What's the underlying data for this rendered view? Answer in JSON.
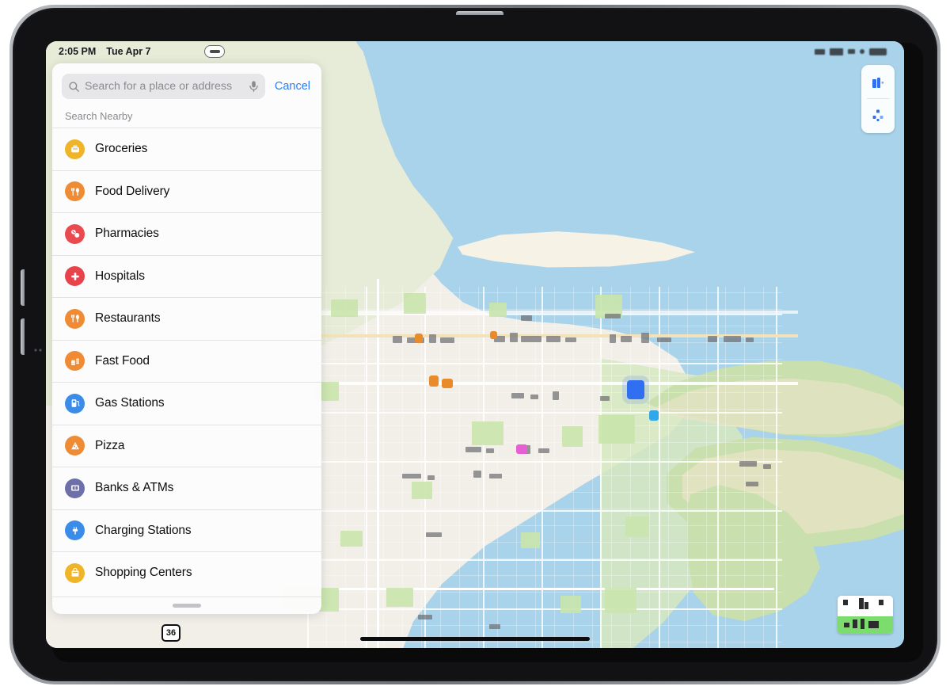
{
  "device": {
    "name": "iPad",
    "orientation": "landscape"
  },
  "status_bar": {
    "time": "2:05 PM",
    "date": "Tue Apr 7",
    "right_icons": [
      "wifi-icon",
      "cellular-signal-icon",
      "bluetooth-icon",
      "battery-icon"
    ]
  },
  "search": {
    "placeholder": "Search for a place or address",
    "value": "",
    "search_icon": "search-icon",
    "mic_icon": "microphone-icon",
    "cancel_label": "Cancel"
  },
  "panel": {
    "section_header": "Search Nearby",
    "grabber": "panel-drag-handle"
  },
  "nearby": {
    "items": [
      {
        "label": "Groceries",
        "icon": "shopping-basket-icon",
        "color": "#f0b429"
      },
      {
        "label": "Food Delivery",
        "icon": "utensils-icon",
        "color": "#ef8b34"
      },
      {
        "label": "Pharmacies",
        "icon": "pills-icon",
        "color": "#ea4a4f"
      },
      {
        "label": "Hospitals",
        "icon": "medical-cross-icon",
        "color": "#e8434a"
      },
      {
        "label": "Restaurants",
        "icon": "utensils-icon",
        "color": "#ef8b34"
      },
      {
        "label": "Fast Food",
        "icon": "burger-fries-icon",
        "color": "#ef8b34"
      },
      {
        "label": "Gas Stations",
        "icon": "fuel-pump-icon",
        "color": "#3b8ce8"
      },
      {
        "label": "Pizza",
        "icon": "pizza-slice-icon",
        "color": "#ef8b34"
      },
      {
        "label": "Banks & ATMs",
        "icon": "banknote-icon",
        "color": "#6d6fa8"
      },
      {
        "label": "Charging Stations",
        "icon": "ev-plug-icon",
        "color": "#3b8ce8"
      },
      {
        "label": "Shopping Centers",
        "icon": "shopping-bag-icon",
        "color": "#f0b429"
      }
    ]
  },
  "map": {
    "controls": [
      {
        "name": "3d-buildings-toggle",
        "icon": "buildings-3d-icon"
      },
      {
        "name": "locate-me-button",
        "icon": "location-arrow-icon"
      }
    ],
    "legend": "map-legend-widget",
    "highway_shield_label": "36",
    "colors": {
      "water": "#a8d3ea",
      "land": "#f2efe9",
      "green": "#c9e0ae",
      "sand": "#eee4c8",
      "road": "#ffffff",
      "arterial": "#f3e2b7"
    }
  },
  "home_indicator": "home-indicator"
}
